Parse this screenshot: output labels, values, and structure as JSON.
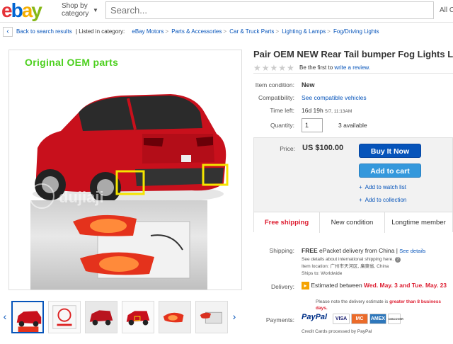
{
  "header": {
    "logo": {
      "e": "e",
      "b": "b",
      "a": "a",
      "y": "y"
    },
    "shop_by_line1": "Shop by",
    "shop_by_line2": "category",
    "search_placeholder": "Search...",
    "category_select": "All C"
  },
  "breadcrumb": {
    "back": "Back to search results",
    "listed_in": "| Listed in category:",
    "items": [
      "eBay Motors",
      "Parts & Accessories",
      "Car & Truck Parts",
      "Lighting & Lamps",
      "Fog/Driving Lights"
    ]
  },
  "gallery": {
    "overlay_label": "Original OEM parts",
    "watermark": "dujiaji",
    "thumb_count": 6
  },
  "listing": {
    "title": "Pair OEM NEW Rear Tail bumper Fog Lights Lamp",
    "rating_text": "Be the first to",
    "rating_link": "write a review.",
    "condition_label": "Item condition:",
    "condition_value": "New",
    "compat_label": "Compatibility:",
    "compat_link": "See compatible vehicles",
    "time_label": "Time left:",
    "time_value": "16d 19h",
    "time_detail": "5/7, 11:13AM",
    "qty_label": "Quantity:",
    "qty_value": "1",
    "available": "3 available",
    "price_label": "Price:",
    "price_value": "US $100.00",
    "buy_now": "Buy It Now",
    "add_cart": "Add to cart",
    "watch": "Add to watch list",
    "collection": "Add to collection",
    "feature_1": "Free shipping",
    "feature_2": "New condition",
    "feature_3": "Longtime member"
  },
  "shipping": {
    "label": "Shipping:",
    "free": "FREE",
    "method": "ePacket delivery from China |",
    "details_link": "See details",
    "note": "See details about international shipping here.",
    "location": "Item location: 广州市天河区, 廣東省, China",
    "ships_to": "Ships to: Worldwide"
  },
  "delivery": {
    "label": "Delivery:",
    "estimated": "Estimated between",
    "dates": "Wed. May. 3 and Tue. May. 23",
    "note_a": "Please note the delivery estimate is",
    "note_b": "greater than 8 business days."
  },
  "payments": {
    "label": "Payments:",
    "paypal": "PayPal",
    "cards": [
      "VISA",
      "MC",
      "AMEX",
      "DISCOVER"
    ],
    "note": "Credit Cards processed by PayPal"
  },
  "colors": {
    "link": "#0654ba",
    "buy_button": "#0654ba",
    "cart_button": "#3498dc",
    "free_shipping": "#dd1e31",
    "oem_label": "#4cd01e",
    "delivery_dates": "#dd1e31"
  }
}
